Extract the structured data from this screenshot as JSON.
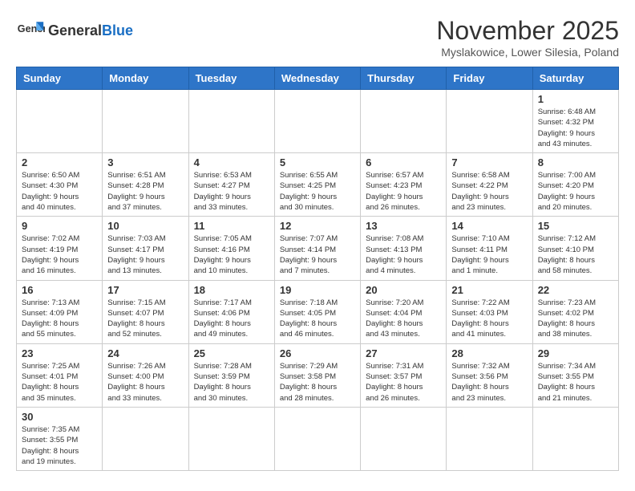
{
  "header": {
    "logo_general": "General",
    "logo_blue": "Blue",
    "month_title": "November 2025",
    "location": "Myslakowice, Lower Silesia, Poland"
  },
  "days_of_week": [
    "Sunday",
    "Monday",
    "Tuesday",
    "Wednesday",
    "Thursday",
    "Friday",
    "Saturday"
  ],
  "weeks": [
    [
      {
        "day": "",
        "info": ""
      },
      {
        "day": "",
        "info": ""
      },
      {
        "day": "",
        "info": ""
      },
      {
        "day": "",
        "info": ""
      },
      {
        "day": "",
        "info": ""
      },
      {
        "day": "",
        "info": ""
      },
      {
        "day": "1",
        "info": "Sunrise: 6:48 AM\nSunset: 4:32 PM\nDaylight: 9 hours\nand 43 minutes."
      }
    ],
    [
      {
        "day": "2",
        "info": "Sunrise: 6:50 AM\nSunset: 4:30 PM\nDaylight: 9 hours\nand 40 minutes."
      },
      {
        "day": "3",
        "info": "Sunrise: 6:51 AM\nSunset: 4:28 PM\nDaylight: 9 hours\nand 37 minutes."
      },
      {
        "day": "4",
        "info": "Sunrise: 6:53 AM\nSunset: 4:27 PM\nDaylight: 9 hours\nand 33 minutes."
      },
      {
        "day": "5",
        "info": "Sunrise: 6:55 AM\nSunset: 4:25 PM\nDaylight: 9 hours\nand 30 minutes."
      },
      {
        "day": "6",
        "info": "Sunrise: 6:57 AM\nSunset: 4:23 PM\nDaylight: 9 hours\nand 26 minutes."
      },
      {
        "day": "7",
        "info": "Sunrise: 6:58 AM\nSunset: 4:22 PM\nDaylight: 9 hours\nand 23 minutes."
      },
      {
        "day": "8",
        "info": "Sunrise: 7:00 AM\nSunset: 4:20 PM\nDaylight: 9 hours\nand 20 minutes."
      }
    ],
    [
      {
        "day": "9",
        "info": "Sunrise: 7:02 AM\nSunset: 4:19 PM\nDaylight: 9 hours\nand 16 minutes."
      },
      {
        "day": "10",
        "info": "Sunrise: 7:03 AM\nSunset: 4:17 PM\nDaylight: 9 hours\nand 13 minutes."
      },
      {
        "day": "11",
        "info": "Sunrise: 7:05 AM\nSunset: 4:16 PM\nDaylight: 9 hours\nand 10 minutes."
      },
      {
        "day": "12",
        "info": "Sunrise: 7:07 AM\nSunset: 4:14 PM\nDaylight: 9 hours\nand 7 minutes."
      },
      {
        "day": "13",
        "info": "Sunrise: 7:08 AM\nSunset: 4:13 PM\nDaylight: 9 hours\nand 4 minutes."
      },
      {
        "day": "14",
        "info": "Sunrise: 7:10 AM\nSunset: 4:11 PM\nDaylight: 9 hours\nand 1 minute."
      },
      {
        "day": "15",
        "info": "Sunrise: 7:12 AM\nSunset: 4:10 PM\nDaylight: 8 hours\nand 58 minutes."
      }
    ],
    [
      {
        "day": "16",
        "info": "Sunrise: 7:13 AM\nSunset: 4:09 PM\nDaylight: 8 hours\nand 55 minutes."
      },
      {
        "day": "17",
        "info": "Sunrise: 7:15 AM\nSunset: 4:07 PM\nDaylight: 8 hours\nand 52 minutes."
      },
      {
        "day": "18",
        "info": "Sunrise: 7:17 AM\nSunset: 4:06 PM\nDaylight: 8 hours\nand 49 minutes."
      },
      {
        "day": "19",
        "info": "Sunrise: 7:18 AM\nSunset: 4:05 PM\nDaylight: 8 hours\nand 46 minutes."
      },
      {
        "day": "20",
        "info": "Sunrise: 7:20 AM\nSunset: 4:04 PM\nDaylight: 8 hours\nand 43 minutes."
      },
      {
        "day": "21",
        "info": "Sunrise: 7:22 AM\nSunset: 4:03 PM\nDaylight: 8 hours\nand 41 minutes."
      },
      {
        "day": "22",
        "info": "Sunrise: 7:23 AM\nSunset: 4:02 PM\nDaylight: 8 hours\nand 38 minutes."
      }
    ],
    [
      {
        "day": "23",
        "info": "Sunrise: 7:25 AM\nSunset: 4:01 PM\nDaylight: 8 hours\nand 35 minutes."
      },
      {
        "day": "24",
        "info": "Sunrise: 7:26 AM\nSunset: 4:00 PM\nDaylight: 8 hours\nand 33 minutes."
      },
      {
        "day": "25",
        "info": "Sunrise: 7:28 AM\nSunset: 3:59 PM\nDaylight: 8 hours\nand 30 minutes."
      },
      {
        "day": "26",
        "info": "Sunrise: 7:29 AM\nSunset: 3:58 PM\nDaylight: 8 hours\nand 28 minutes."
      },
      {
        "day": "27",
        "info": "Sunrise: 7:31 AM\nSunset: 3:57 PM\nDaylight: 8 hours\nand 26 minutes."
      },
      {
        "day": "28",
        "info": "Sunrise: 7:32 AM\nSunset: 3:56 PM\nDaylight: 8 hours\nand 23 minutes."
      },
      {
        "day": "29",
        "info": "Sunrise: 7:34 AM\nSunset: 3:55 PM\nDaylight: 8 hours\nand 21 minutes."
      }
    ],
    [
      {
        "day": "30",
        "info": "Sunrise: 7:35 AM\nSunset: 3:55 PM\nDaylight: 8 hours\nand 19 minutes."
      },
      {
        "day": "",
        "info": ""
      },
      {
        "day": "",
        "info": ""
      },
      {
        "day": "",
        "info": ""
      },
      {
        "day": "",
        "info": ""
      },
      {
        "day": "",
        "info": ""
      },
      {
        "day": "",
        "info": ""
      }
    ]
  ]
}
